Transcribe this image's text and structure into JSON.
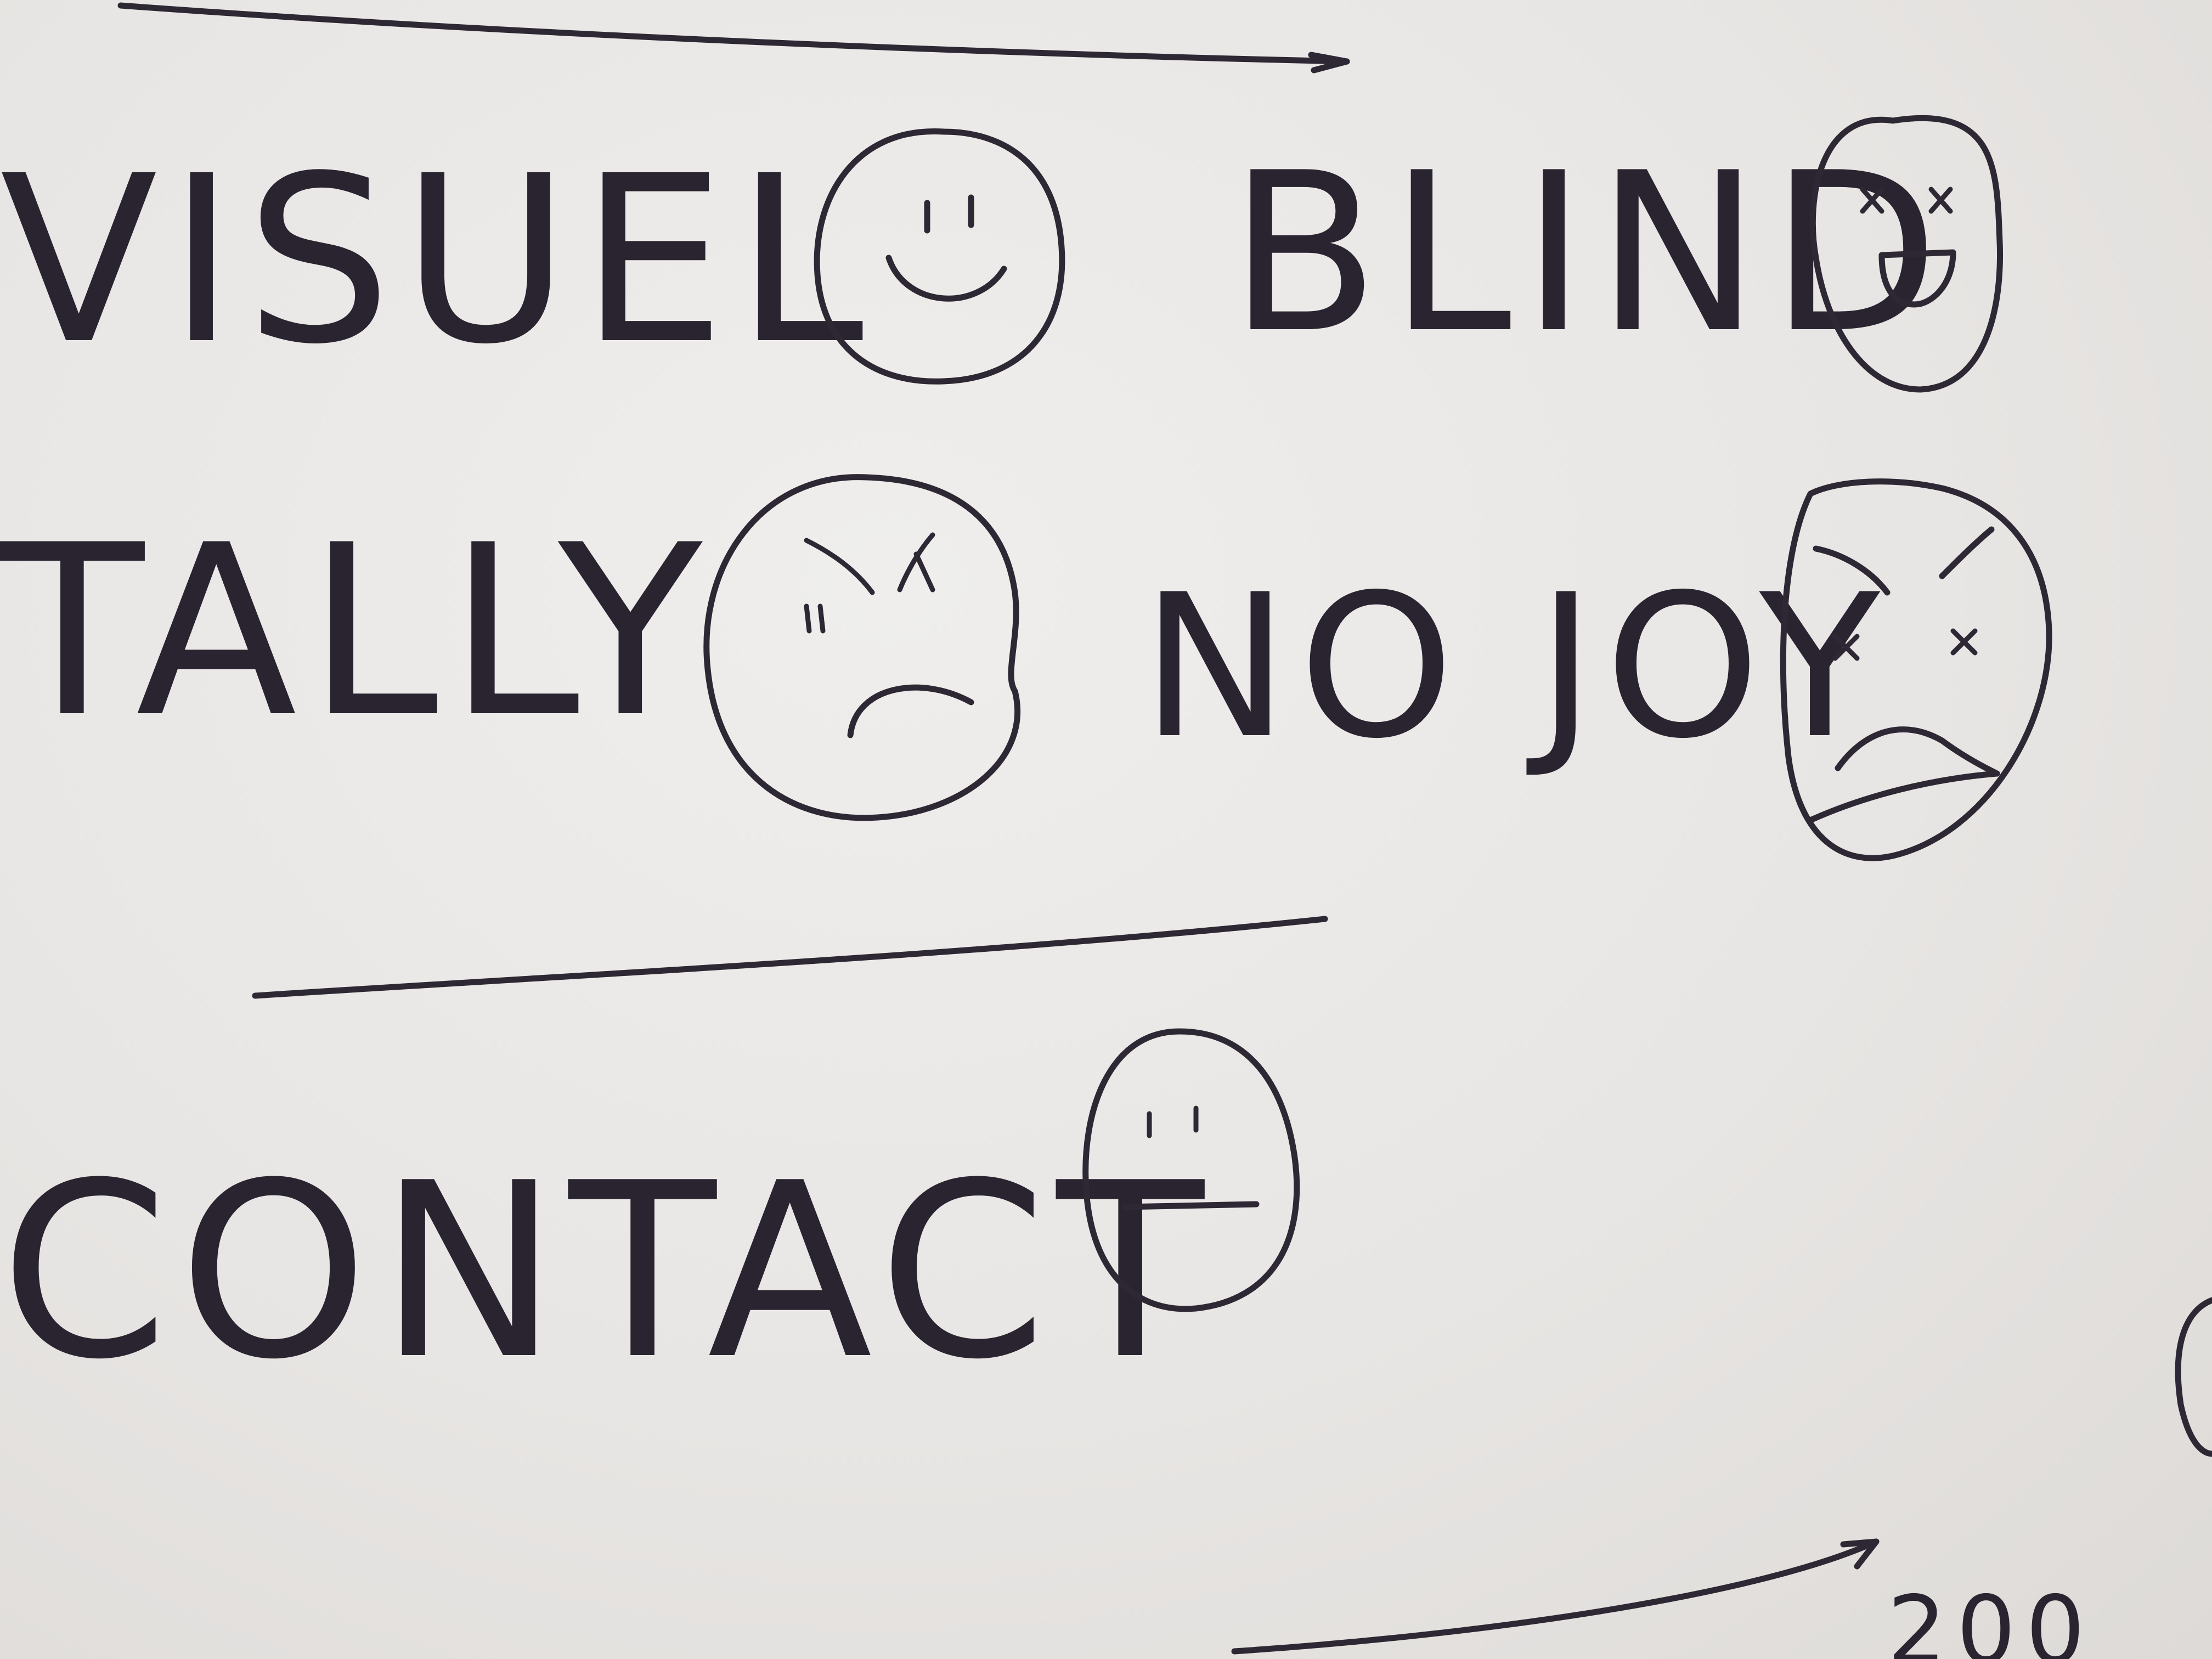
{
  "sketch": {
    "rows": [
      {
        "label": "VISUEL",
        "face": "happy-face-icon"
      },
      {
        "label": "BLIND",
        "face": "dizzy-laughing-face-icon"
      },
      {
        "label": "TALLY",
        "face": "angry-face-icon"
      },
      {
        "label": "NO JOY",
        "face": "dead-sad-face-icon"
      },
      {
        "label": "CONTACT",
        "face": "neutral-face-icon"
      }
    ],
    "corner_number": "200"
  },
  "colors": {
    "paper": "#e9e7e5",
    "ink": "#2e2834"
  }
}
